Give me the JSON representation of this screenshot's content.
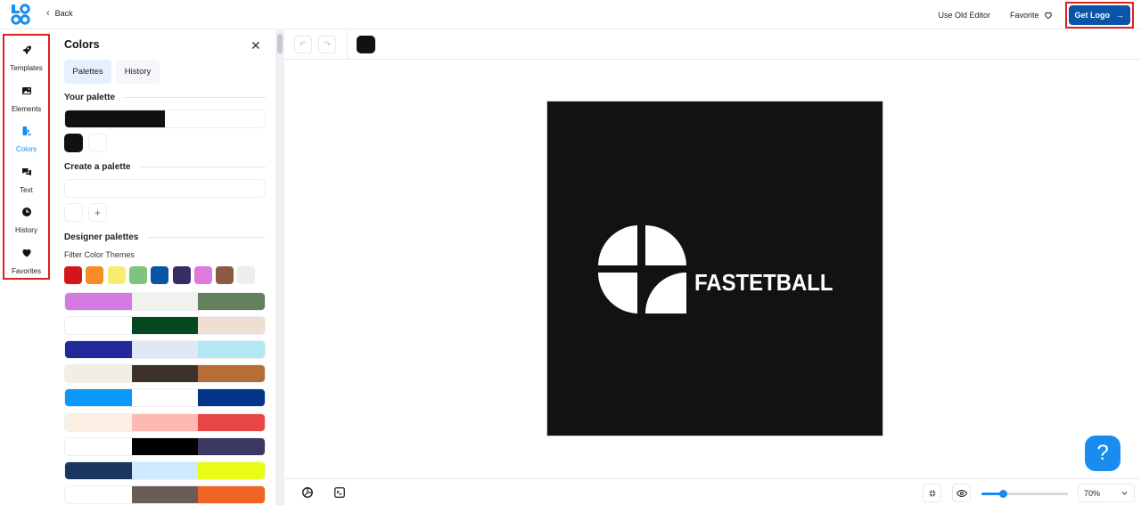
{
  "header": {
    "logo_alt": "LOGO",
    "back_label": "Back",
    "use_old_editor_label": "Use Old Editor",
    "favorite_label": "Favorite",
    "get_logo_label": "Get Logo",
    "brand_color": "#0a55a8"
  },
  "rail": {
    "items": [
      {
        "label": "Templates",
        "icon": "rocket-icon",
        "active": false
      },
      {
        "label": "Elements",
        "icon": "image-icon",
        "active": false
      },
      {
        "label": "Colors",
        "icon": "color-palette-icon",
        "active": true
      },
      {
        "label": "Text",
        "icon": "chat-bubbles-icon",
        "active": false
      },
      {
        "label": "History",
        "icon": "clock-icon",
        "active": false
      },
      {
        "label": "Favorites",
        "icon": "heart-icon",
        "active": false
      }
    ],
    "active_color": "#1a8cf0"
  },
  "panel": {
    "title": "Colors",
    "tabs": [
      {
        "label": "Palettes",
        "active": true
      },
      {
        "label": "History",
        "active": false
      }
    ],
    "your_palette": {
      "heading": "Your palette",
      "colors": [
        "#111111",
        "#ffffff"
      ]
    },
    "create_palette": {
      "heading": "Create a palette",
      "colors": [
        "#ffffff"
      ],
      "add_label": "+"
    },
    "designer_palettes": {
      "heading": "Designer palettes",
      "filter_label": "Filter Color Themes",
      "filter_colors": [
        "#d2161c",
        "#f68c25",
        "#f7ec6e",
        "#7ec47e",
        "#0a55a3",
        "#372c63",
        "#de7ade",
        "#8e5a43",
        "#eeeeee"
      ],
      "palettes": [
        [
          "#d47ae0",
          "#f1f1ee",
          "#64805c"
        ],
        [
          "#ffffff",
          "#034820",
          "#efdfd0"
        ],
        [
          "#21299b",
          "#e0e8f8",
          "#b4e6f4"
        ],
        [
          "#f1eee3",
          "#3e3129",
          "#b66e39"
        ],
        [
          "#0a98fa",
          "#ffffff",
          "#00358a"
        ],
        [
          "#fbf0e3",
          "#ffb9b4",
          "#e84645"
        ],
        [
          "#ffffff",
          "#000000",
          "#3b3961"
        ],
        [
          "#1b365e",
          "#cfeaff",
          "#e9fc15"
        ],
        [
          "#ffffff",
          "#6a5c57",
          "#f06424"
        ]
      ]
    }
  },
  "toolbar": {
    "undo_label": "↶",
    "redo_label": "↷",
    "selected_color": "#111111"
  },
  "canvas": {
    "background_color": "#121212",
    "brand_name": "FASTETBALL",
    "mark_color": "#ffffff"
  },
  "bottombar": {
    "zoom_percent": 70,
    "zoom_label": "70%",
    "slider_fraction": 0.25
  },
  "help": {
    "label": "?"
  }
}
